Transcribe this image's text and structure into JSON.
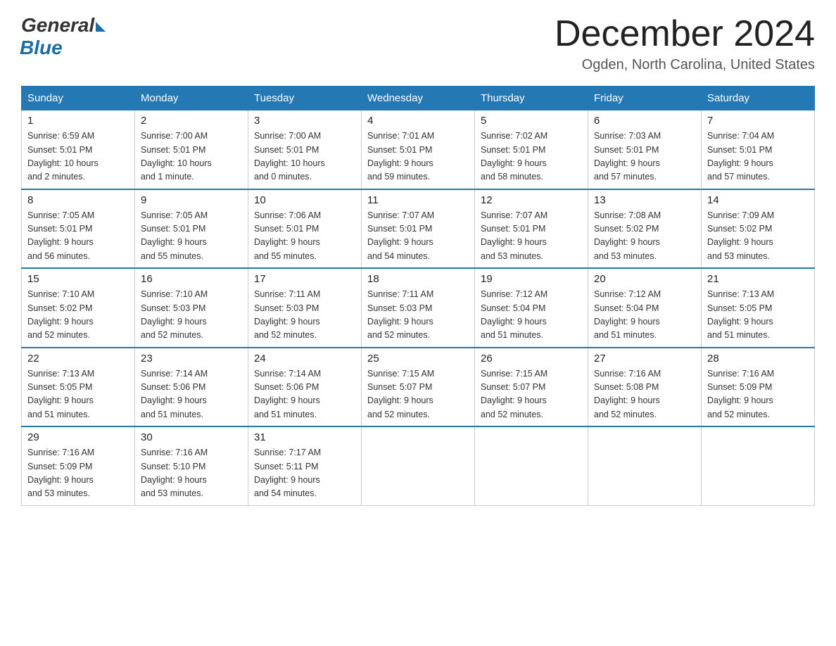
{
  "header": {
    "logo_general": "General",
    "logo_blue": "Blue",
    "month_title": "December 2024",
    "location": "Ogden, North Carolina, United States"
  },
  "days_of_week": [
    "Sunday",
    "Monday",
    "Tuesday",
    "Wednesday",
    "Thursday",
    "Friday",
    "Saturday"
  ],
  "weeks": [
    [
      {
        "day": "1",
        "info": "Sunrise: 6:59 AM\nSunset: 5:01 PM\nDaylight: 10 hours\nand 2 minutes."
      },
      {
        "day": "2",
        "info": "Sunrise: 7:00 AM\nSunset: 5:01 PM\nDaylight: 10 hours\nand 1 minute."
      },
      {
        "day": "3",
        "info": "Sunrise: 7:00 AM\nSunset: 5:01 PM\nDaylight: 10 hours\nand 0 minutes."
      },
      {
        "day": "4",
        "info": "Sunrise: 7:01 AM\nSunset: 5:01 PM\nDaylight: 9 hours\nand 59 minutes."
      },
      {
        "day": "5",
        "info": "Sunrise: 7:02 AM\nSunset: 5:01 PM\nDaylight: 9 hours\nand 58 minutes."
      },
      {
        "day": "6",
        "info": "Sunrise: 7:03 AM\nSunset: 5:01 PM\nDaylight: 9 hours\nand 57 minutes."
      },
      {
        "day": "7",
        "info": "Sunrise: 7:04 AM\nSunset: 5:01 PM\nDaylight: 9 hours\nand 57 minutes."
      }
    ],
    [
      {
        "day": "8",
        "info": "Sunrise: 7:05 AM\nSunset: 5:01 PM\nDaylight: 9 hours\nand 56 minutes."
      },
      {
        "day": "9",
        "info": "Sunrise: 7:05 AM\nSunset: 5:01 PM\nDaylight: 9 hours\nand 55 minutes."
      },
      {
        "day": "10",
        "info": "Sunrise: 7:06 AM\nSunset: 5:01 PM\nDaylight: 9 hours\nand 55 minutes."
      },
      {
        "day": "11",
        "info": "Sunrise: 7:07 AM\nSunset: 5:01 PM\nDaylight: 9 hours\nand 54 minutes."
      },
      {
        "day": "12",
        "info": "Sunrise: 7:07 AM\nSunset: 5:01 PM\nDaylight: 9 hours\nand 53 minutes."
      },
      {
        "day": "13",
        "info": "Sunrise: 7:08 AM\nSunset: 5:02 PM\nDaylight: 9 hours\nand 53 minutes."
      },
      {
        "day": "14",
        "info": "Sunrise: 7:09 AM\nSunset: 5:02 PM\nDaylight: 9 hours\nand 53 minutes."
      }
    ],
    [
      {
        "day": "15",
        "info": "Sunrise: 7:10 AM\nSunset: 5:02 PM\nDaylight: 9 hours\nand 52 minutes."
      },
      {
        "day": "16",
        "info": "Sunrise: 7:10 AM\nSunset: 5:03 PM\nDaylight: 9 hours\nand 52 minutes."
      },
      {
        "day": "17",
        "info": "Sunrise: 7:11 AM\nSunset: 5:03 PM\nDaylight: 9 hours\nand 52 minutes."
      },
      {
        "day": "18",
        "info": "Sunrise: 7:11 AM\nSunset: 5:03 PM\nDaylight: 9 hours\nand 52 minutes."
      },
      {
        "day": "19",
        "info": "Sunrise: 7:12 AM\nSunset: 5:04 PM\nDaylight: 9 hours\nand 51 minutes."
      },
      {
        "day": "20",
        "info": "Sunrise: 7:12 AM\nSunset: 5:04 PM\nDaylight: 9 hours\nand 51 minutes."
      },
      {
        "day": "21",
        "info": "Sunrise: 7:13 AM\nSunset: 5:05 PM\nDaylight: 9 hours\nand 51 minutes."
      }
    ],
    [
      {
        "day": "22",
        "info": "Sunrise: 7:13 AM\nSunset: 5:05 PM\nDaylight: 9 hours\nand 51 minutes."
      },
      {
        "day": "23",
        "info": "Sunrise: 7:14 AM\nSunset: 5:06 PM\nDaylight: 9 hours\nand 51 minutes."
      },
      {
        "day": "24",
        "info": "Sunrise: 7:14 AM\nSunset: 5:06 PM\nDaylight: 9 hours\nand 51 minutes."
      },
      {
        "day": "25",
        "info": "Sunrise: 7:15 AM\nSunset: 5:07 PM\nDaylight: 9 hours\nand 52 minutes."
      },
      {
        "day": "26",
        "info": "Sunrise: 7:15 AM\nSunset: 5:07 PM\nDaylight: 9 hours\nand 52 minutes."
      },
      {
        "day": "27",
        "info": "Sunrise: 7:16 AM\nSunset: 5:08 PM\nDaylight: 9 hours\nand 52 minutes."
      },
      {
        "day": "28",
        "info": "Sunrise: 7:16 AM\nSunset: 5:09 PM\nDaylight: 9 hours\nand 52 minutes."
      }
    ],
    [
      {
        "day": "29",
        "info": "Sunrise: 7:16 AM\nSunset: 5:09 PM\nDaylight: 9 hours\nand 53 minutes."
      },
      {
        "day": "30",
        "info": "Sunrise: 7:16 AM\nSunset: 5:10 PM\nDaylight: 9 hours\nand 53 minutes."
      },
      {
        "day": "31",
        "info": "Sunrise: 7:17 AM\nSunset: 5:11 PM\nDaylight: 9 hours\nand 54 minutes."
      },
      {
        "day": "",
        "info": ""
      },
      {
        "day": "",
        "info": ""
      },
      {
        "day": "",
        "info": ""
      },
      {
        "day": "",
        "info": ""
      }
    ]
  ]
}
